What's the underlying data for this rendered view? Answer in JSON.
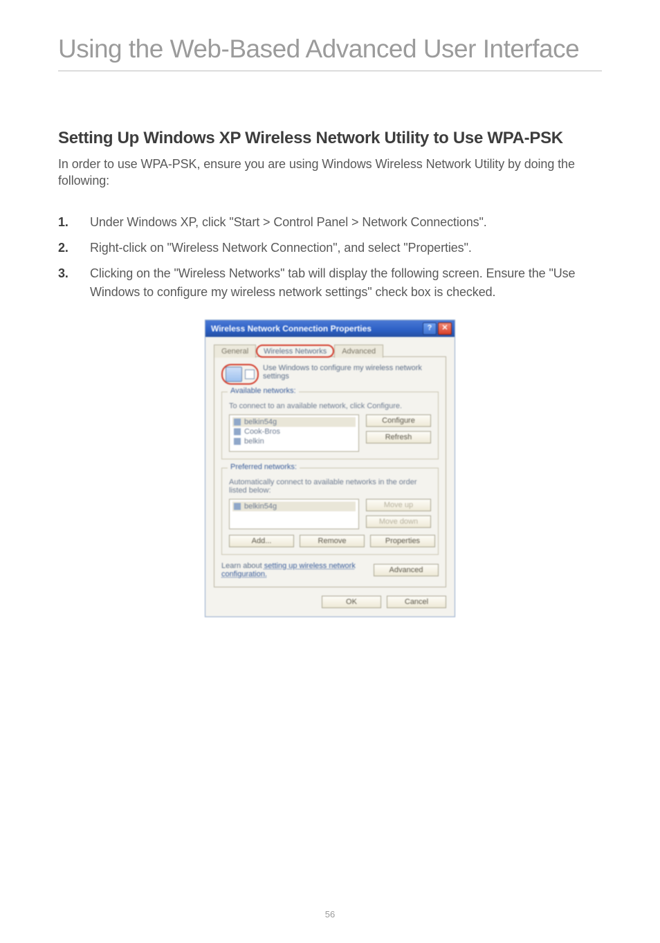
{
  "header": {
    "title": "Using the Web-Based Advanced User Interface"
  },
  "section": {
    "heading": "Setting Up Windows XP Wireless Network Utility to Use WPA-PSK",
    "intro": "In order to use WPA-PSK, ensure you are using Windows Wireless Network Utility by doing the following:"
  },
  "steps": [
    {
      "num": "1.",
      "text": "Under Windows XP, click \"Start > Control Panel > Network Connections\"."
    },
    {
      "num": "2.",
      "text": "Right-click on \"Wireless Network Connection\", and select \"Properties\"."
    },
    {
      "num": "3.",
      "text": "Clicking on the \"Wireless Networks\" tab will display the following screen. Ensure the \"Use Windows to configure my wireless network settings\" check box is checked."
    }
  ],
  "dialog": {
    "title": "Wireless Network Connection Properties",
    "help_glyph": "?",
    "close_glyph": "✕",
    "tabs": {
      "general": "General",
      "wireless": "Wireless Networks",
      "advanced": "Advanced"
    },
    "use_windows_label": "Use Windows to configure my wireless network settings",
    "available": {
      "title": "Available networks:",
      "note": "To connect to an available network, click Configure.",
      "items": [
        "belkin54g",
        "Cook-Bros",
        "belkin"
      ],
      "configure_btn": "Configure",
      "refresh_btn": "Refresh"
    },
    "preferred": {
      "title": "Preferred networks:",
      "note": "Automatically connect to available networks in the order listed below:",
      "items": [
        "belkin54g"
      ],
      "moveup_btn": "Move up",
      "movedown_btn": "Move down",
      "add_btn": "Add...",
      "remove_btn": "Remove",
      "properties_btn": "Properties"
    },
    "learn_text_1": "Learn about ",
    "learn_link": "setting up wireless network configuration.",
    "advanced_btn": "Advanced",
    "ok_btn": "OK",
    "cancel_btn": "Cancel"
  },
  "page_number": "56"
}
